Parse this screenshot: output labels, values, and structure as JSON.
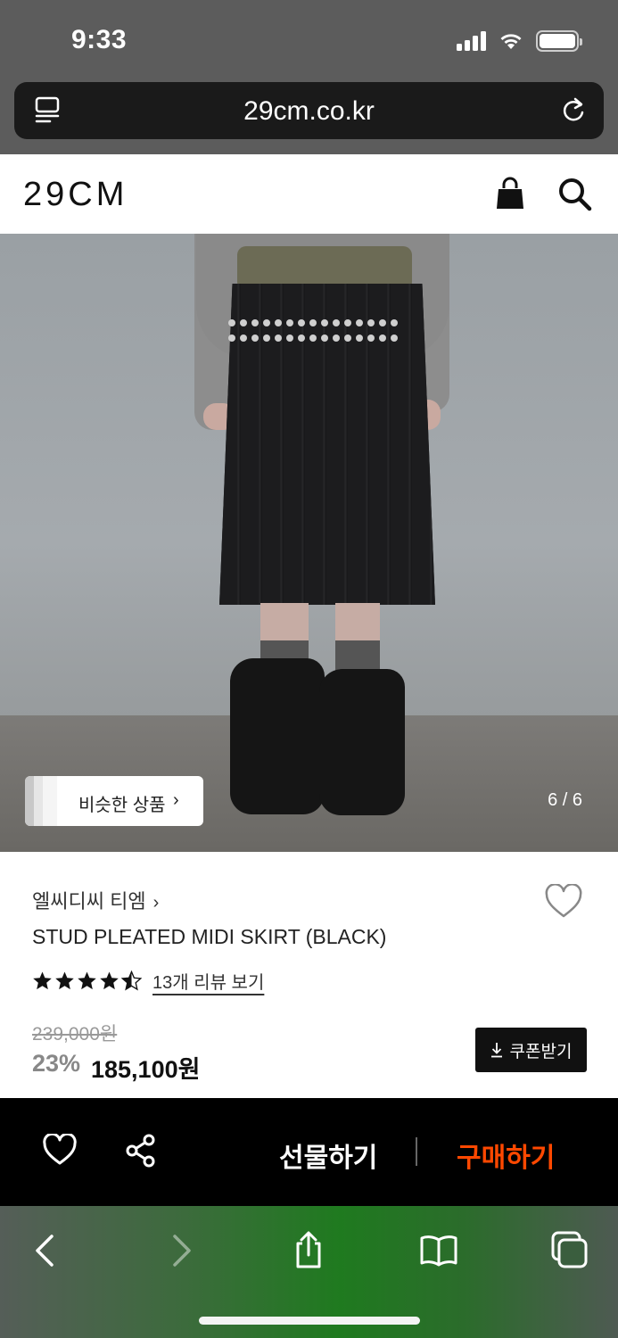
{
  "status_bar": {
    "time": "9:33"
  },
  "browser": {
    "url": "29cm.co.kr"
  },
  "header": {
    "logo": "29CM"
  },
  "gallery": {
    "similar_products_label": "비슷한 상품",
    "page_indicator": "6 / 6"
  },
  "product": {
    "brand": "엘씨디씨 티엠",
    "title": "STUD PLEATED MIDI SKIRT (BLACK)",
    "rating": 4.5,
    "reviews_label": "13개 리뷰 보기",
    "original_price": "239,000원",
    "discount": "23%",
    "sale_price": "185,100원",
    "coupon_label": "쿠폰받기"
  },
  "action_bar": {
    "gift_label": "선물하기",
    "buy_label": "구매하기",
    "buy_color": "#ff4800"
  },
  "icons": [
    "reader-icon",
    "reload-icon",
    "shopping-bag-icon",
    "search-icon",
    "heart-icon",
    "share-icon",
    "back-icon",
    "forward-icon",
    "share-up-icon",
    "bookmarks-icon",
    "tabs-icon"
  ]
}
